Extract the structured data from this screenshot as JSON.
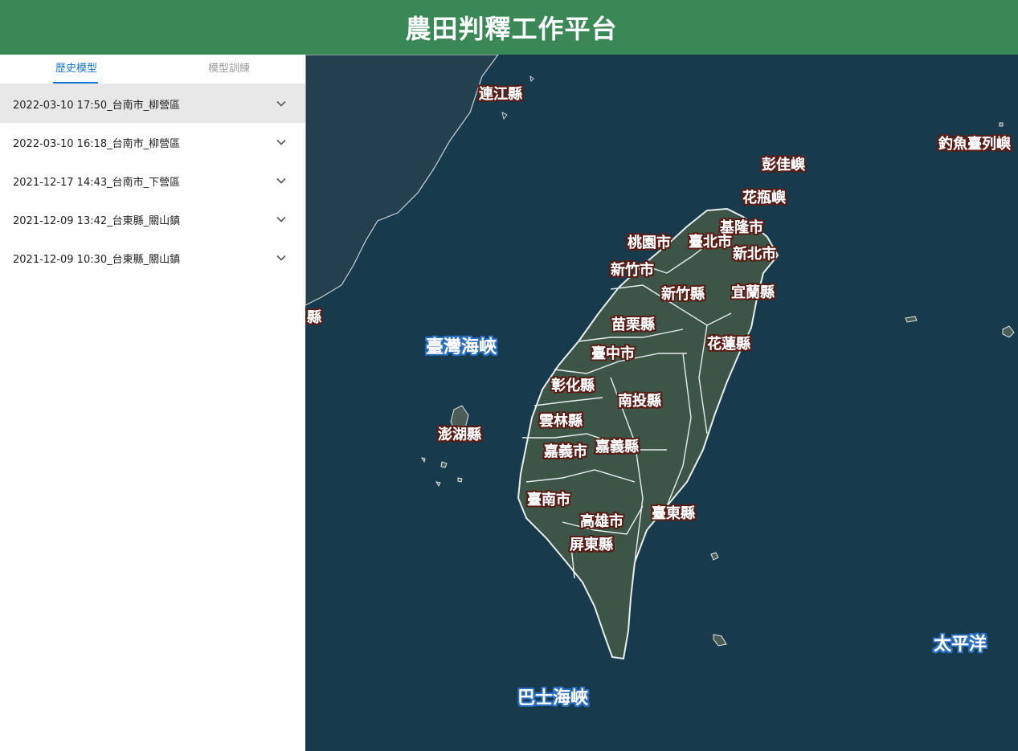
{
  "header": {
    "title": "農田判釋工作平台"
  },
  "tabs": [
    {
      "label": "歷史模型",
      "active": true
    },
    {
      "label": "模型訓練",
      "active": false
    }
  ],
  "history": [
    {
      "label": "2022-03-10 17:50_台南市_柳營區",
      "selected": true
    },
    {
      "label": "2022-03-10 16:18_台南市_柳營區",
      "selected": false
    },
    {
      "label": "2021-12-17 14:43_台南市_下營區",
      "selected": false
    },
    {
      "label": "2021-12-09 13:42_台東縣_關山鎮",
      "selected": false
    },
    {
      "label": "2021-12-09 10:30_台東縣_關山鎮",
      "selected": false
    }
  ],
  "map": {
    "water_labels": {
      "taiwan_strait": "臺灣海峽",
      "bashi_channel": "巴士海峽",
      "pacific": "太平洋"
    },
    "place_labels": {
      "lienchiang": "連江縣",
      "diaoyutai": "釣魚臺列嶼",
      "pengjia": "彭佳嶼",
      "huaping": "花瓶嶼",
      "keelung": "基隆市",
      "taoyuan": "桃園市",
      "taipei": "臺北市",
      "newtaipei": "新北市",
      "hsinchu_city": "新竹市",
      "hsinchu_county": "新竹縣",
      "yilan": "宜蘭縣",
      "miaoli": "苗栗縣",
      "taichung": "臺中市",
      "hualien": "花蓮縣",
      "changhua": "彰化縣",
      "nantou": "南投縣",
      "yunlin": "雲林縣",
      "penghu": "澎湖縣",
      "chiayi_city": "嘉義市",
      "chiayi_county": "嘉義縣",
      "tainan": "臺南市",
      "kaohsiung": "高雄市",
      "taitung": "臺東縣",
      "pingtung": "屏東縣",
      "kinmen_partial": "縣"
    },
    "colors": {
      "ocean": "#183a4d",
      "land": "#3d5546",
      "border": "#e8eef0"
    }
  },
  "colors": {
    "header_bg": "#3a8856",
    "accent": "#1976d2",
    "selected_bg": "#e8e8e8"
  },
  "icons": {
    "expand": "chevron-down-icon"
  }
}
